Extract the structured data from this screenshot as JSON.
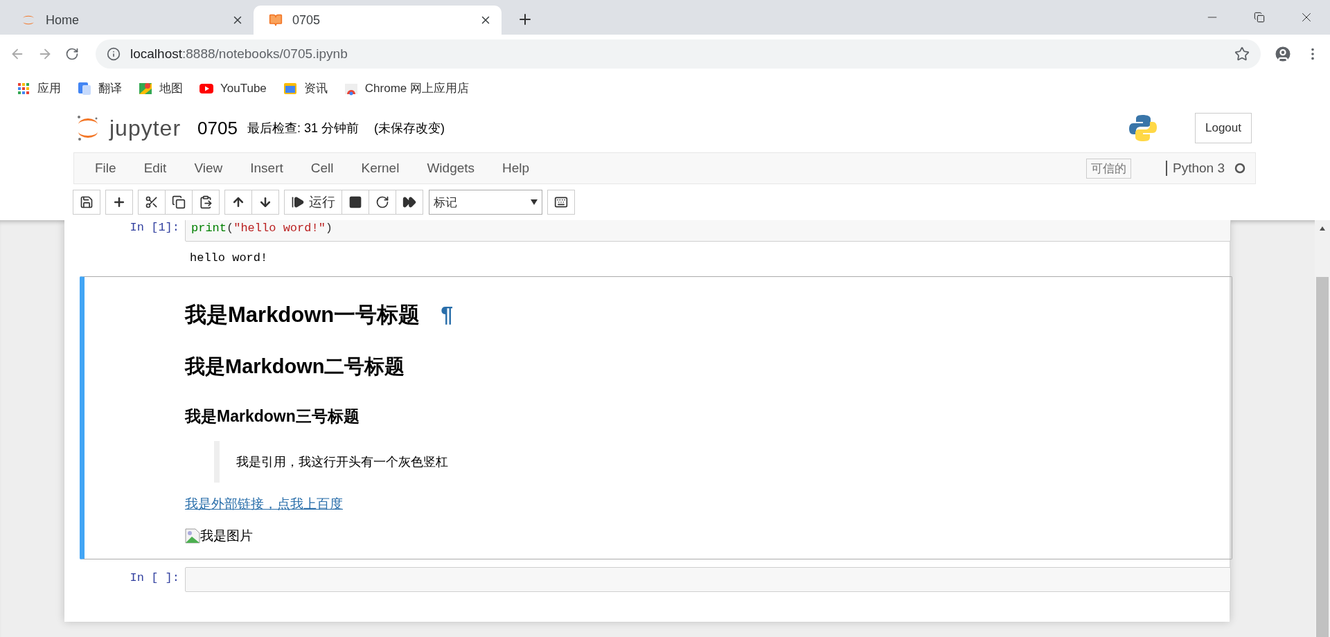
{
  "browser": {
    "tabs": [
      {
        "kind": "home",
        "title": "Home",
        "selected": false
      },
      {
        "kind": "notebook",
        "title": "0705",
        "selected": true
      }
    ],
    "address": {
      "host": "localhost",
      "path": ":8888/notebooks/0705.ipynb"
    },
    "bookmarks": [
      {
        "kind": "apps",
        "label": "应用"
      },
      {
        "kind": "translate",
        "label": "翻译"
      },
      {
        "kind": "maps",
        "label": "地图"
      },
      {
        "kind": "youtube",
        "label": "YouTube"
      },
      {
        "kind": "news",
        "label": "资讯"
      },
      {
        "kind": "store",
        "label": "Chrome 网上应用店"
      }
    ]
  },
  "header": {
    "logo_text": "jupyter",
    "notebook_name": "0705",
    "checkpoint": "最后检查: 31 分钟前",
    "save_status": "(未保存改变)",
    "logout": "Logout"
  },
  "menu": {
    "items": [
      "File",
      "Edit",
      "View",
      "Insert",
      "Cell",
      "Kernel",
      "Widgets",
      "Help"
    ],
    "trusted": "可信的",
    "kernel": "Python 3",
    "kernel_busy": false
  },
  "toolbar": {
    "groups": [
      [
        {
          "kind": "save"
        }
      ],
      [
        {
          "kind": "insert"
        }
      ],
      [
        {
          "kind": "cut"
        },
        {
          "kind": "copy"
        },
        {
          "kind": "paste"
        }
      ],
      [
        {
          "kind": "up"
        },
        {
          "kind": "down"
        }
      ],
      [
        {
          "kind": "run",
          "label": "运行"
        },
        {
          "kind": "stop"
        },
        {
          "kind": "restart"
        },
        {
          "kind": "run-all"
        }
      ],
      [
        {
          "kind": "cell-type",
          "label": "标记"
        }
      ],
      [
        {
          "kind": "keyboard"
        }
      ]
    ]
  },
  "cells": [
    {
      "kind": "code",
      "selected": false,
      "prompt": "In [1]:",
      "tokens": [
        {
          "kind": "builtin",
          "text": "print"
        },
        {
          "kind": "punct",
          "text": "("
        },
        {
          "kind": "string",
          "text": "\"hello word!\""
        },
        {
          "kind": "punct",
          "text": ")"
        }
      ],
      "output": "hello word!"
    },
    {
      "kind": "markdown",
      "selected": true,
      "blocks": [
        {
          "kind": "h1",
          "text": "我是Markdown一号标题",
          "anchor": "¶"
        },
        {
          "kind": "h2",
          "text": "我是Markdown二号标题"
        },
        {
          "kind": "h3",
          "text": "我是Markdown三号标题"
        },
        {
          "kind": "quote",
          "text": "我是引用，我这行开头有一个灰色竖杠"
        },
        {
          "kind": "link",
          "text": "我是外部链接，点我上百度"
        },
        {
          "kind": "image",
          "text": "我是图片"
        }
      ]
    },
    {
      "kind": "code",
      "selected": false,
      "prompt": "In [ ]:"
    }
  ]
}
